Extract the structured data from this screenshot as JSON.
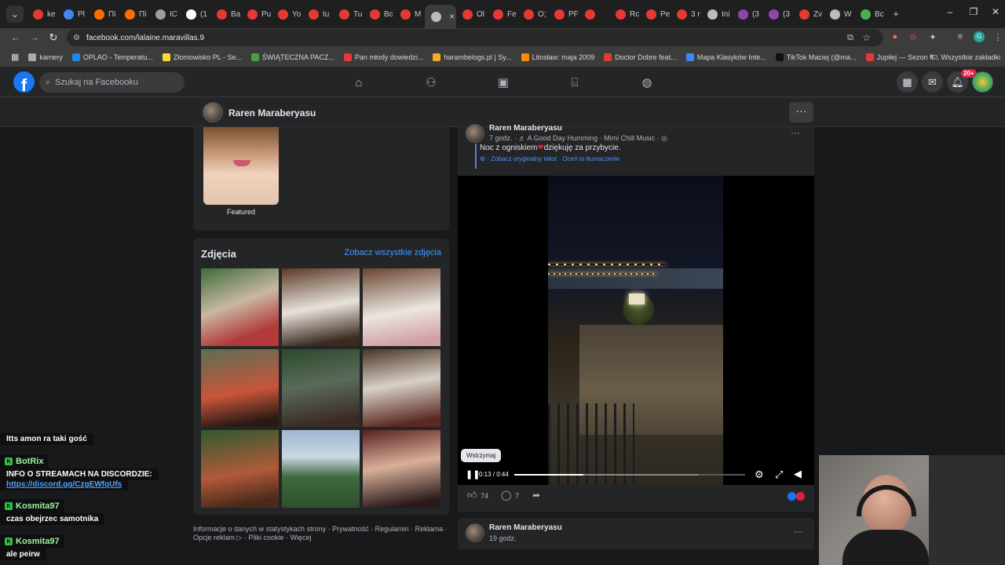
{
  "browser": {
    "tabs": [
      "ke",
      "Pl",
      "Пі",
      "Пі",
      "IC",
      "(1",
      "Ba",
      "Pu",
      "Yo",
      "tu",
      "Tu",
      "Bc",
      "M",
      "",
      "Ol",
      "Fe",
      "O;",
      "PF",
      "",
      "Rc",
      "Pe",
      "3 r",
      "Ini",
      "(3",
      "(3",
      "Zv",
      "W",
      "Bc"
    ],
    "tab_colors": [
      "#e53935",
      "#4285f4",
      "#ff6d00",
      "#ff6d00",
      "#9e9e9e",
      "#ffffff",
      "#e53935",
      "#e53935",
      "#e53935",
      "#e53935",
      "#e53935",
      "#e53935",
      "#e53935",
      "#bbbbbb",
      "#e53935",
      "#e53935",
      "#e53935",
      "#e53935",
      "#e53935",
      "#e53935",
      "#e53935",
      "#e53935",
      "#bbbbbb",
      "#8e44ad",
      "#8e44ad",
      "#e53935",
      "#bbbbbb",
      "#4caf50"
    ],
    "active_tab_index": 13,
    "url": "facebook.com/lalaine.maravillas.9",
    "bookmarks": [
      {
        "label": "kamery",
        "color": "#aaaaaa"
      },
      {
        "label": "OPLAO - Temperatu...",
        "color": "#1e88e5"
      },
      {
        "label": "Złomowisko PL - Se...",
        "color": "#fdd835"
      },
      {
        "label": "ŚWIĄTECZNA PACZ...",
        "color": "#43a047"
      },
      {
        "label": "Pan młody dowiedzi...",
        "color": "#e53935"
      },
      {
        "label": "harambelogs.pl | Sy...",
        "color": "#f9a825"
      },
      {
        "label": "Litosław: maja 2009",
        "color": "#fb8c00"
      },
      {
        "label": "Doctor Dobre feat...",
        "color": "#e53935"
      },
      {
        "label": "Mapa Klasyków Inte...",
        "color": "#4285f4"
      },
      {
        "label": "TikTok Maciej (@ma...",
        "color": "#111111"
      },
      {
        "label": "Jupiłej — Sezon ft...",
        "color": "#e53935"
      }
    ],
    "bookmarks_all": "Wszystkie zakładki"
  },
  "fb": {
    "logo": "f",
    "search_placeholder": "Szukaj na Facebooku",
    "notification_count": "20+",
    "profile_name": "Raren Maraberyasu",
    "featured_label": "Featured",
    "photos_title": "Zdjęcia",
    "see_all_photos": "Zobacz wszystkie zdjęcia",
    "footer_line1": "Informacje o danych w statystykach strony · Prywatność · Regulamin · Reklama ·",
    "footer_line2": "Opcje reklam ▷ · Pliki cookie · Więcej"
  },
  "post": {
    "author": "Raren Maraberyasu",
    "time": "7 godz.",
    "music": "♬ A Good Day Humming · Mimi Chill Music",
    "text_before": "Noc z ogniskiem",
    "text_after": "dziękuję za przybycie.",
    "see_original": "Zobacz oryginalny tekst",
    "rate_translation": "Oceń to tłumaczenie",
    "tooltip": "Wstrzymaj",
    "video_time": "0:13 / 0:44",
    "video_progress": 0.3,
    "video_buffered": 0.8,
    "likes": "74",
    "comments": "7"
  },
  "next_post": {
    "author": "Raren Maraberyasu",
    "time": "19 godz."
  },
  "chat": [
    {
      "type": "text",
      "text": "Itts amon ra taki gość"
    },
    {
      "type": "name",
      "text": "BotRix"
    },
    {
      "type": "text",
      "text": "INFO O STREAMACH NA DISCORDZIE:"
    },
    {
      "type": "link",
      "text": "https://discord.gg/CzgEWfqUfs"
    },
    {
      "type": "name",
      "text": "Kosmita97"
    },
    {
      "type": "text",
      "text": "czas obejrzec samotnika"
    },
    {
      "type": "name",
      "text": "Kosmita97"
    },
    {
      "type": "text",
      "text": "ale peirw"
    }
  ],
  "colors": {
    "fb_blue": "#1877f2",
    "link_blue": "#4599ff",
    "chat_name_green": "#9ef0a0",
    "heart_red": "#e41e3f"
  }
}
